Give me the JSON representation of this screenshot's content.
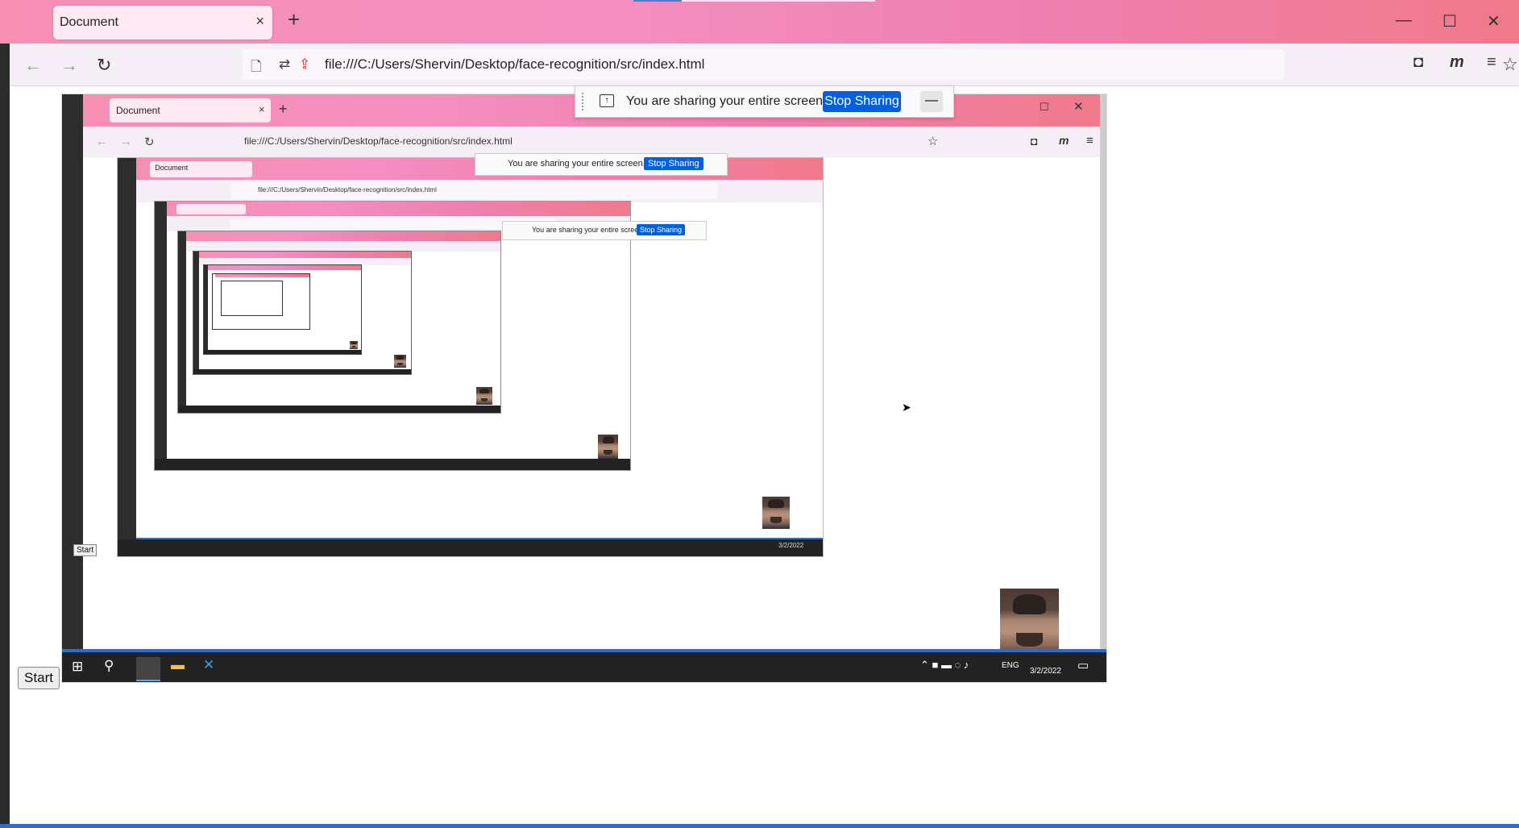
{
  "browser": {
    "tab_title": "Document",
    "tab_close": "×",
    "new_tab": "+",
    "url": "file:///C:/Users/Shervin/Desktop/face-recognition/src/index.html",
    "window_controls": {
      "minimize": "—",
      "maximize": "☐",
      "close": "✕"
    }
  },
  "sharing_bar": {
    "message": "You are sharing your entire screen.",
    "stop_label": "Stop Sharing",
    "minimize_label": "—"
  },
  "captured": {
    "tab_title": "Document",
    "url": "file:///C:/Users/Shervin/Desktop/face-recognition/src/index.html",
    "share_message": "You are sharing your entire screen.",
    "stop_label": "Stop Sharing",
    "start_label": "Start",
    "lang": "ENG",
    "date": "3/2/2022"
  },
  "nested": {
    "tab_title": "Document",
    "url": "file:///C:/Users/Shervin/Desktop/face-recognition/src/index.html",
    "share_message": "You are sharing your entire screen.",
    "stop_label": "Stop Sharing",
    "start_label": "Start",
    "lang": "ENG",
    "date": "3/2/2022"
  },
  "page": {
    "start_label": "Start"
  },
  "icons": {
    "back": "back-arrow-icon",
    "forward": "forward-arrow-icon",
    "reload": "reload-icon",
    "star": "bookmark-star-icon",
    "pocket": "pocket-icon",
    "extension": "m-extension-icon",
    "menu": "hamburger-menu-icon"
  },
  "colors": {
    "titlebar_gradient": [
      "#f78fb3",
      "#f07a8a"
    ],
    "stop_button": "#0060df",
    "taskbar": "#222222"
  }
}
